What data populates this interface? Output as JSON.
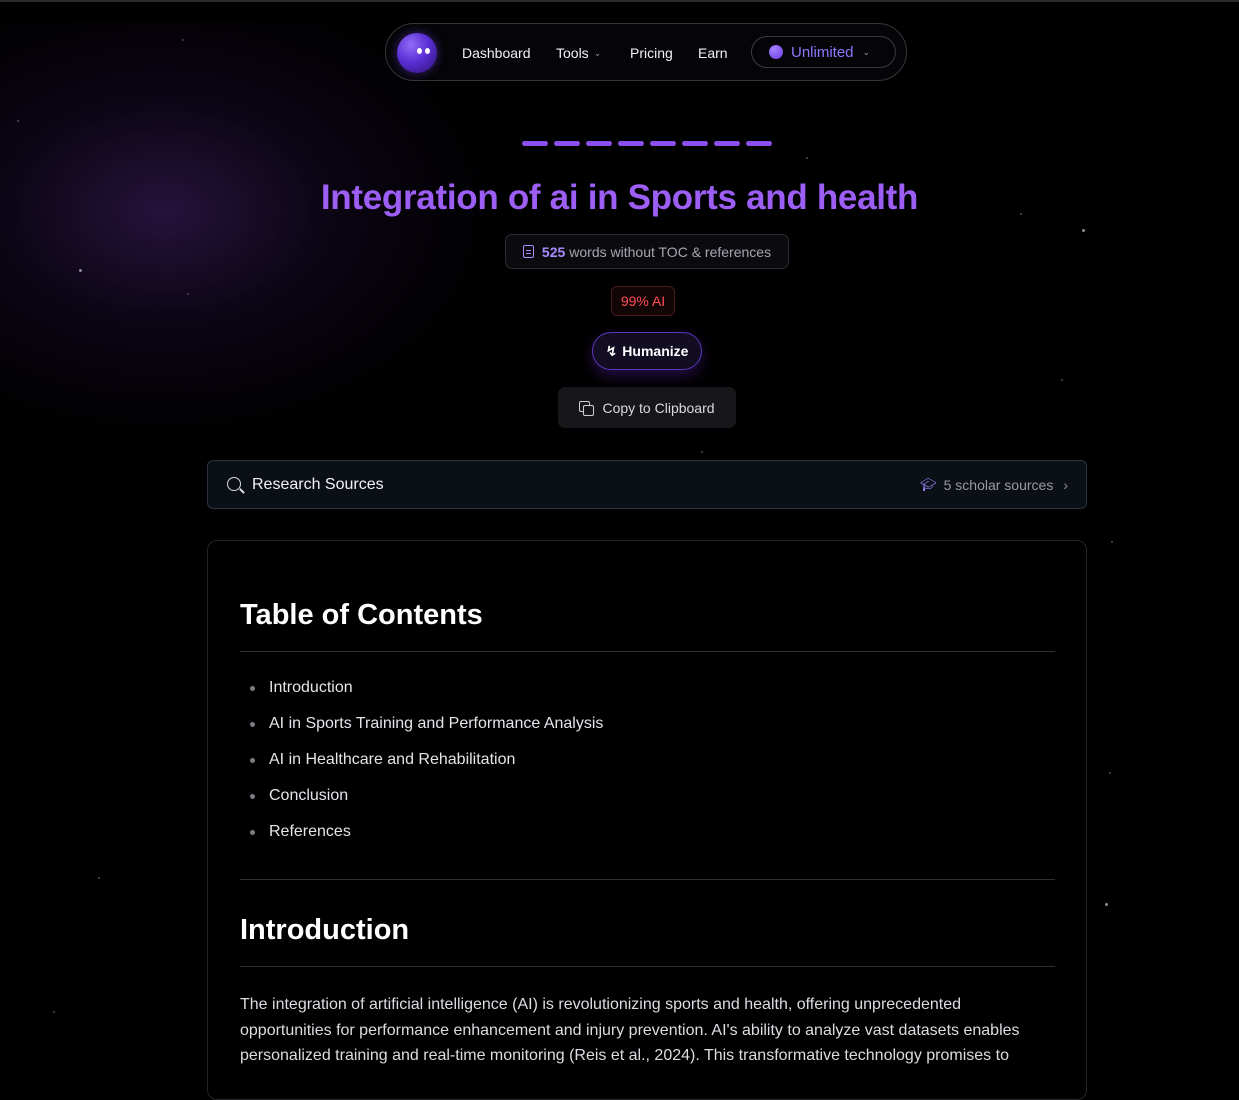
{
  "nav": {
    "items": [
      "Dashboard",
      "Tools",
      "Pricing",
      "Earn"
    ],
    "plan_label": "Unlimited"
  },
  "page": {
    "title": "Integration of ai in Sports and health",
    "word_count": "525",
    "word_count_suffix": "words without TOC & references",
    "ai_score": "99% AI",
    "humanize_label": "Humanize",
    "copy_label": "Copy to Clipboard"
  },
  "research": {
    "label": "Research Sources",
    "sources": "5 scholar sources"
  },
  "document": {
    "toc_heading": "Table of Contents",
    "toc_items": [
      "Introduction",
      "AI in Sports Training and Performance Analysis",
      "AI in Healthcare and Rehabilitation",
      "Conclusion",
      "References"
    ],
    "intro_heading": "Introduction",
    "intro_text": "The integration of artificial intelligence (AI) is revolutionizing sports and health, offering unprecedented opportunities for performance enhancement and injury prevention. AI's ability to analyze vast datasets enables personalized training and real-time monitoring (Reis et al., 2024). This transformative technology promises to"
  },
  "colors": {
    "accent": "#9d5ef5",
    "ai_score": "#ff4d55",
    "background": "#000000"
  }
}
